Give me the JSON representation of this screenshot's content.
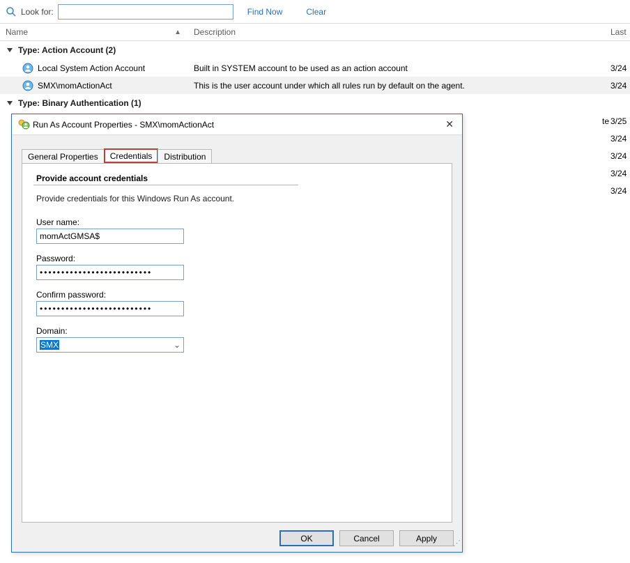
{
  "toolbar": {
    "look_for_label": "Look for:",
    "search_value": "",
    "find_now": "Find Now",
    "clear": "Clear"
  },
  "grid": {
    "columns": {
      "name": "Name",
      "description": "Description",
      "last": "Last"
    }
  },
  "groups": [
    {
      "header": "Type: Action Account (2)",
      "rows": [
        {
          "name": "Local System Action Account",
          "desc": "Built in SYSTEM account to be used as an action account",
          "last": "3/24",
          "selected": false
        },
        {
          "name": "SMX\\momActionAct",
          "desc": "This is the user account under which all rules run by default on the agent.",
          "last": "3/24",
          "selected": true
        }
      ]
    },
    {
      "header": "Type: Binary Authentication (1)",
      "rows": [
        {
          "name": "",
          "desc": "te",
          "last": "3/25",
          "selected": false
        }
      ]
    }
  ],
  "partial_dates": [
    "3/24",
    "3/24",
    "3/24",
    "3/24"
  ],
  "dialog": {
    "title": "Run As Account Properties - SMX\\momActionAct",
    "tabs": {
      "general": "General Properties",
      "credentials": "Credentials",
      "distribution": "Distribution"
    },
    "section_title": "Provide account credentials",
    "hint": "Provide credentials for this Windows Run As account.",
    "fields": {
      "username_label": "User name:",
      "username_value": "momActGMSA$",
      "password_label": "Password:",
      "password_value": "••••••••••••••••••••••••••",
      "confirm_label": "Confirm password:",
      "confirm_value": "••••••••••••••••••••••••••",
      "domain_label": "Domain:",
      "domain_value": "SMX"
    },
    "buttons": {
      "ok": "OK",
      "cancel": "Cancel",
      "apply": "Apply"
    }
  }
}
